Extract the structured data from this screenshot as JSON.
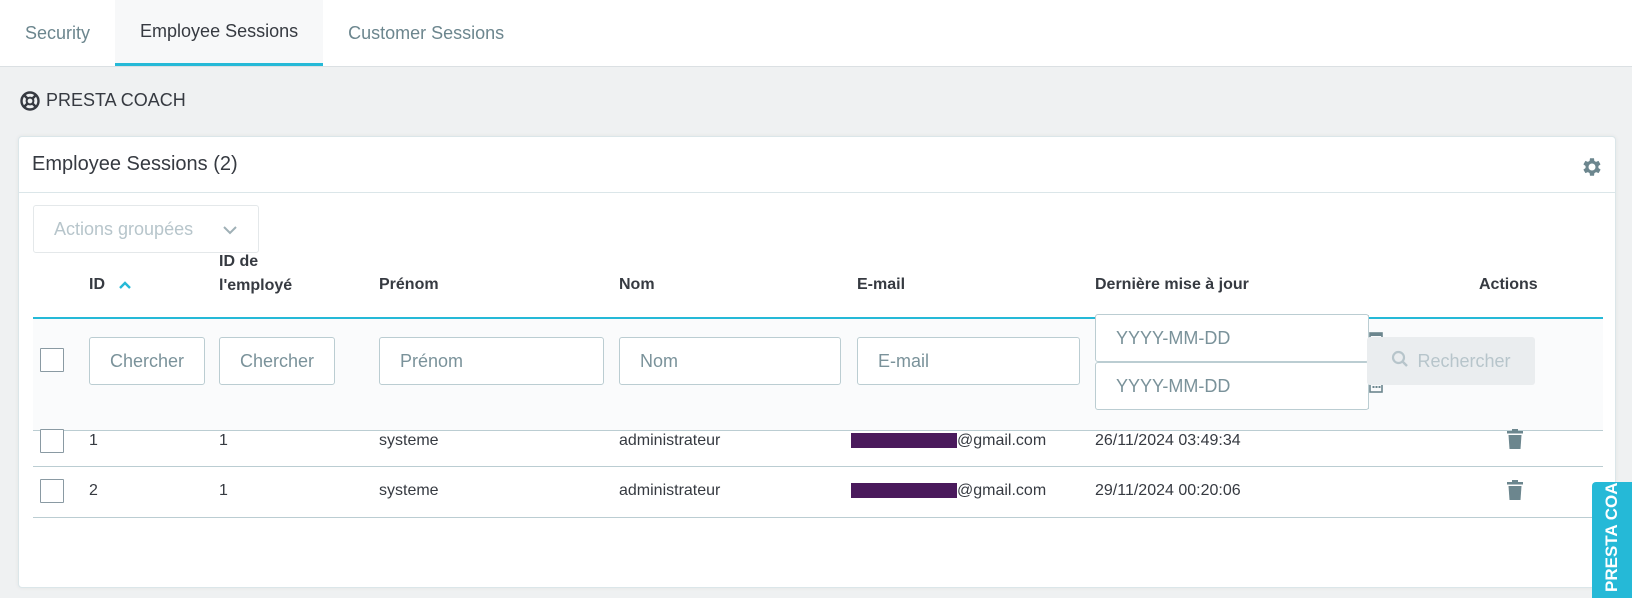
{
  "tabs": [
    {
      "label": "Security"
    },
    {
      "label": "Employee Sessions"
    },
    {
      "label": "Customer Sessions"
    }
  ],
  "coach": {
    "label": "PRESTA COACH"
  },
  "panel": {
    "title": "Employee Sessions (2)"
  },
  "bulk_actions": {
    "label": "Actions groupées"
  },
  "columns": {
    "id": "ID",
    "employee_id_line1": "ID de",
    "employee_id_line2": "l'employé",
    "firstname": "Prénom",
    "lastname": "Nom",
    "email": "E-mail",
    "last_update": "Dernière mise à jour",
    "actions": "Actions"
  },
  "filters": {
    "id_placeholder": "Chercher",
    "employee_id_placeholder": "Chercher",
    "firstname_placeholder": "Prénom",
    "lastname_placeholder": "Nom",
    "email_placeholder": "E-mail",
    "date_from_placeholder": "YYYY-MM-DD",
    "date_to_placeholder": "YYYY-MM-DD",
    "search_label": "Rechercher"
  },
  "rows": [
    {
      "id": "1",
      "employee_id": "1",
      "firstname": "systeme",
      "lastname": "administrateur",
      "email_suffix": "@gmail.com",
      "last_update": "26/11/2024 03:49:34"
    },
    {
      "id": "2",
      "employee_id": "1",
      "firstname": "systeme",
      "lastname": "administrateur",
      "email_suffix": "@gmail.com",
      "last_update": "29/11/2024 00:20:06"
    }
  ],
  "side_tab": {
    "label": "PRESTA COACH"
  },
  "colors": {
    "accent": "#25b9d7",
    "redaction": "#4a1a5c"
  }
}
